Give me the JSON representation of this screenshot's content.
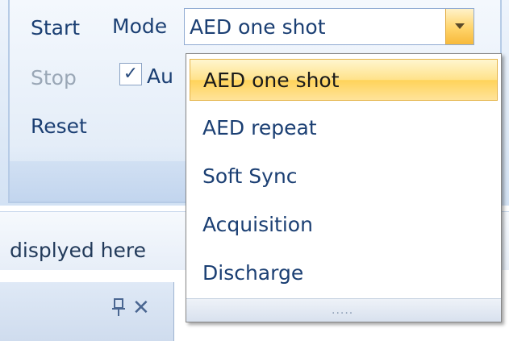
{
  "ribbon": {
    "commands": {
      "start": "Start",
      "stop": "Stop",
      "reset": "Reset"
    },
    "mode": {
      "label": "Mode",
      "selected_value": "AED one shot"
    },
    "auto_checkbox": {
      "checked": true,
      "label_visible": "Au"
    }
  },
  "status": {
    "text": "displyed here"
  },
  "pane": {
    "pin_icon": "pin-icon",
    "close_glyph": "✕"
  },
  "dropdown": {
    "options": [
      "AED one shot",
      "AED repeat",
      "Soft Sync",
      "Acquisition",
      "Discharge"
    ],
    "selected_index": 0,
    "grip_glyph": "....."
  },
  "colors": {
    "text": "#1b3f73",
    "disabled": "#9aa7b6",
    "highlight": "#ffe28a",
    "border": "#8faad2"
  }
}
